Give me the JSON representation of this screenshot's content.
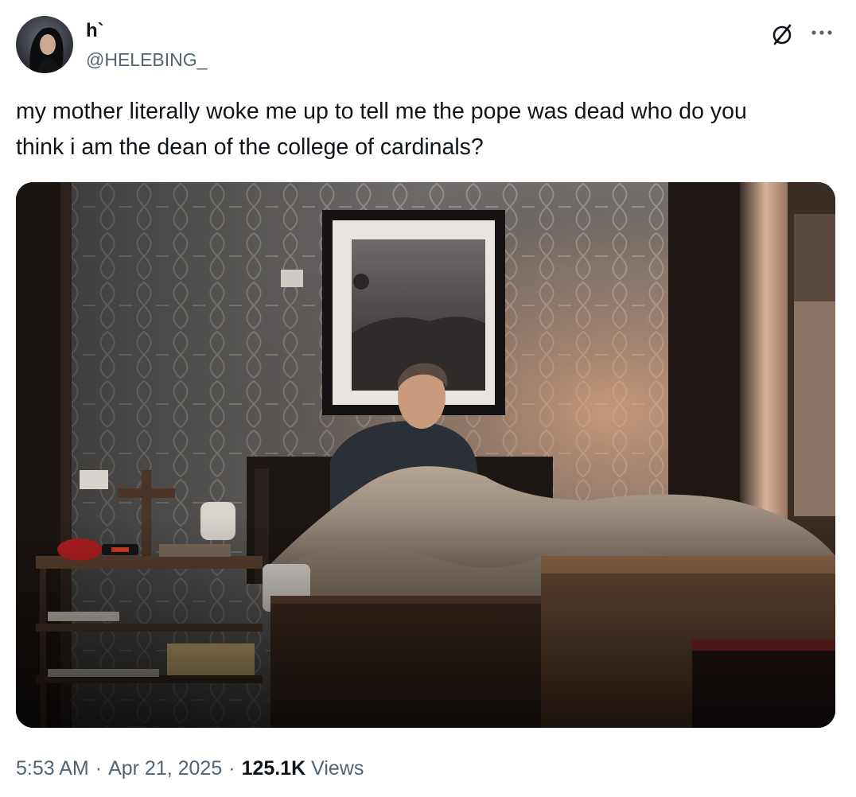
{
  "author": {
    "display_name": "h`",
    "handle": "@HELEBING_"
  },
  "header_icons": [
    "grok-icon",
    "more-options-icon"
  ],
  "tweet": {
    "text": "my mother literally woke me up to tell me the pope was dead who do you\nthink i am the dean of the college of cardinals?"
  },
  "meta": {
    "time": "5:53 AM",
    "date": "Apr 21, 2025",
    "separator": "·",
    "views_count": "125.1K",
    "views_label": "Views"
  },
  "colors": {
    "text_primary": "#0f1419",
    "text_secondary": "#536471"
  }
}
